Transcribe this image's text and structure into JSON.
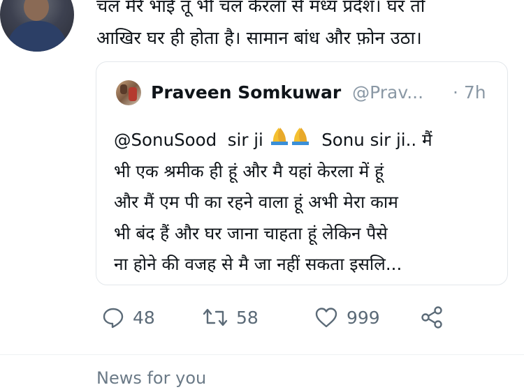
{
  "tweet": {
    "text": "चल मेरे भाई तू भी चल केरला से मध्य प्रदेश। घर तो\nआखिर घर ही होता है। सामान बांध और फ़ोन उठा।"
  },
  "quote": {
    "author_name": "Praveen Somkuwar",
    "handle": "@Prav...",
    "time": "· 7h",
    "mention": "@SonuSood",
    "line1_text": "sir ji",
    "line1_after": "Sonu sir ji.. मैं",
    "line2": "भी एक श्रमीक ही हूं और मै यहां केरला में हूं",
    "line3": "और मैं एम पी का रहने वाला हूं  अभी मेरा काम",
    "line4": "भी बंद हैं और घर जाना चाहता हूं लेकिन पैसे",
    "line5": "ना होने की वजह से  मै जा नहीं सकता इसलि..."
  },
  "actions": {
    "reply_count": "48",
    "retweet_count": "58",
    "like_count": "999"
  },
  "section": {
    "news_label": "News for you"
  },
  "icons": {
    "reply": "reply-icon",
    "retweet": "retweet-icon",
    "like": "heart-icon",
    "share": "share-icon",
    "emoji": "folded-hands-emoji"
  },
  "colors": {
    "text": "#0f1419",
    "secondary": "#5b6a77",
    "border": "#e3e7eb",
    "emoji": "#f4c030"
  }
}
